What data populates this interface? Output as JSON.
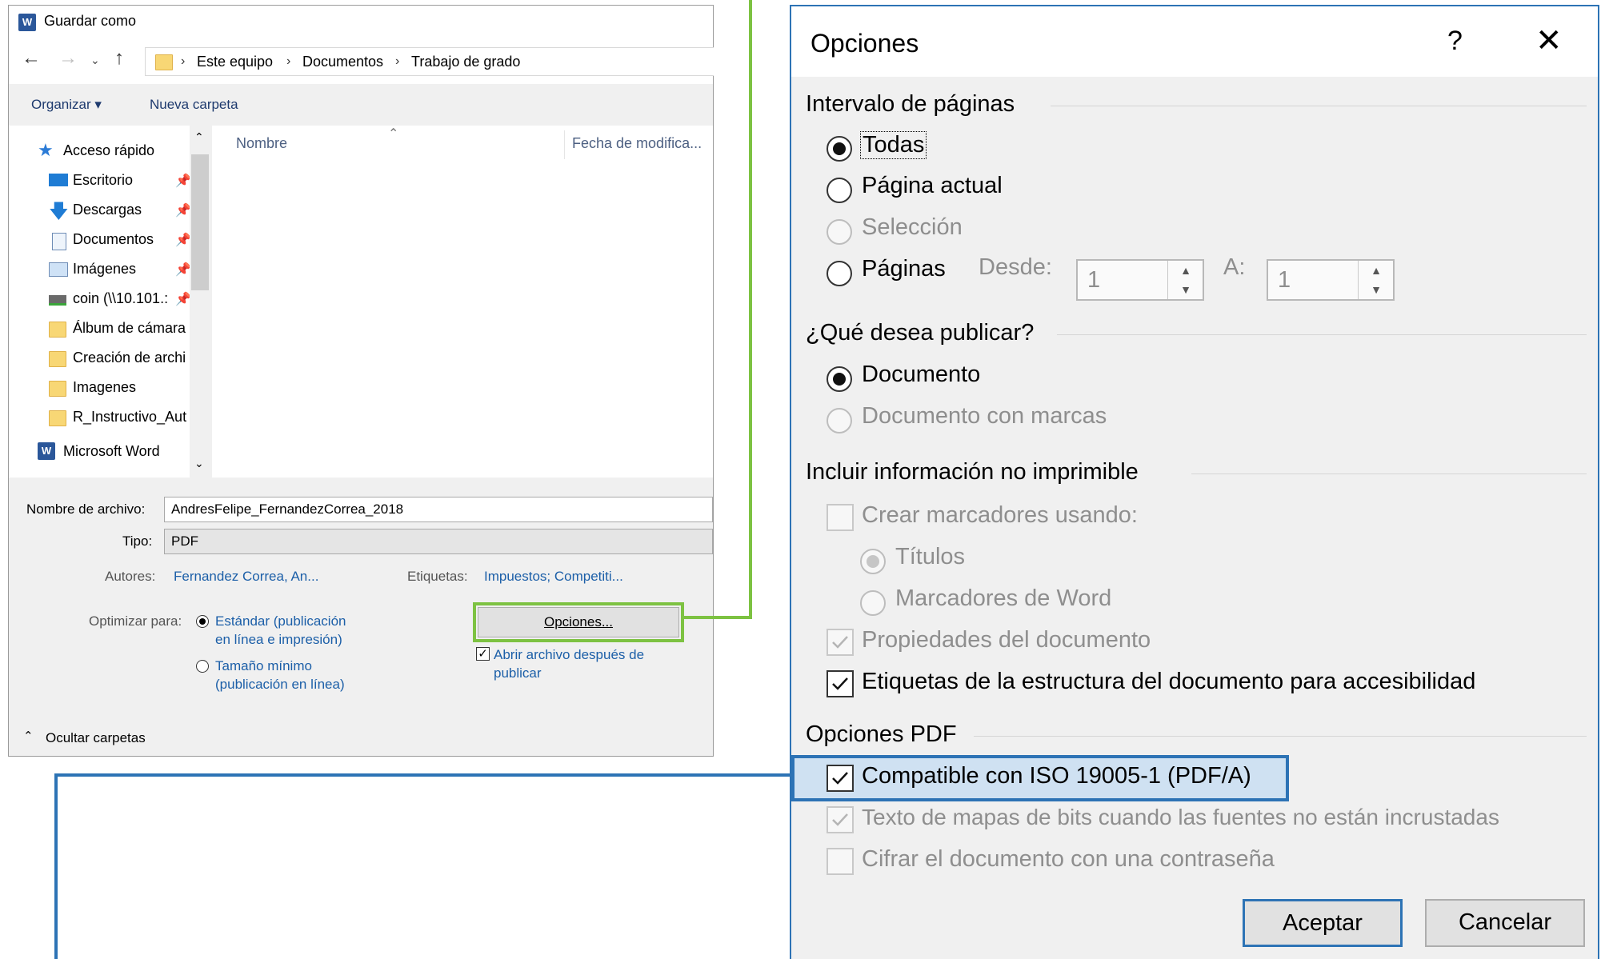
{
  "save_as": {
    "title": "Guardar como",
    "app_icon": "W",
    "breadcrumb": [
      "Este equipo",
      "Documentos",
      "Trabajo de grado"
    ],
    "toolbar": {
      "organize": "Organizar ▾",
      "new_folder": "Nueva carpeta"
    },
    "nav_items": [
      {
        "label": "Acceso rápido",
        "icon": "star-icon",
        "pinned": false
      },
      {
        "label": "Escritorio",
        "icon": "desktop-icon",
        "pinned": true
      },
      {
        "label": "Descargas",
        "icon": "download-icon",
        "pinned": true
      },
      {
        "label": "Documentos",
        "icon": "documents-icon",
        "pinned": true
      },
      {
        "label": "Imágenes",
        "icon": "pictures-icon",
        "pinned": true
      },
      {
        "label": "coin (\\\\10.101.:",
        "icon": "network-drive-icon",
        "pinned": true
      },
      {
        "label": "Álbum de cámara",
        "icon": "folder-icon",
        "pinned": false
      },
      {
        "label": "Creación de archi",
        "icon": "folder-icon",
        "pinned": false
      },
      {
        "label": "Imagenes",
        "icon": "folder-icon",
        "pinned": false
      },
      {
        "label": "R_Instructivo_Aut",
        "icon": "folder-icon",
        "pinned": false
      },
      {
        "label": "Microsoft Word",
        "icon": "word-icon",
        "pinned": false
      }
    ],
    "columns": {
      "name": "Nombre",
      "modified": "Fecha de modifica..."
    },
    "filename_label": "Nombre de archivo:",
    "filename_value": "AndresFelipe_FernandezCorrea_2018",
    "type_label": "Tipo:",
    "type_value": "PDF",
    "authors_label": "Autores:",
    "authors_value": "Fernandez Correa, An...",
    "tags_label": "Etiquetas:",
    "tags_value": "Impuestos; Competiti...",
    "optimize_label": "Optimizar para:",
    "optimize_standard": [
      "Estándar (publicación",
      "en línea e impresión)"
    ],
    "optimize_minimum": [
      "Tamaño mínimo",
      "(publicación en línea)"
    ],
    "options_button": "Opciones...",
    "open_after": [
      "Abrir archivo después de",
      "publicar"
    ],
    "hide_folders": "Ocultar carpetas"
  },
  "options": {
    "title": "Opciones",
    "help": "?",
    "close": "✕",
    "page_range": {
      "heading": "Intervalo de páginas",
      "all": "Todas",
      "current": "Página actual",
      "selection": "Selección",
      "pages": "Páginas",
      "from_label": "Desde:",
      "from_value": "1",
      "to_label": "A:",
      "to_value": "1"
    },
    "publish": {
      "heading": "¿Qué desea publicar?",
      "document": "Documento",
      "document_markup": "Documento con marcas"
    },
    "nonprint": {
      "heading": "Incluir información no imprimible",
      "create_bookmarks": "Crear marcadores usando:",
      "headings": "Títulos",
      "word_bookmarks": "Marcadores de Word",
      "doc_properties": "Propiedades del documento",
      "structure_tags": "Etiquetas de la estructura del documento para accesibilidad"
    },
    "pdf": {
      "heading": "Opciones PDF",
      "iso": "Compatible con ISO 19005-1 (PDF/A)",
      "bitmap_text": "Texto de mapas de bits cuando las fuentes no están incrustadas",
      "encrypt": "Cifrar el documento con una contraseña"
    },
    "ok": "Aceptar",
    "cancel": "Cancelar"
  },
  "colors": {
    "highlight_green": "#7dc242",
    "highlight_blue": "#2d73b5",
    "link": "#1c5fa8"
  }
}
